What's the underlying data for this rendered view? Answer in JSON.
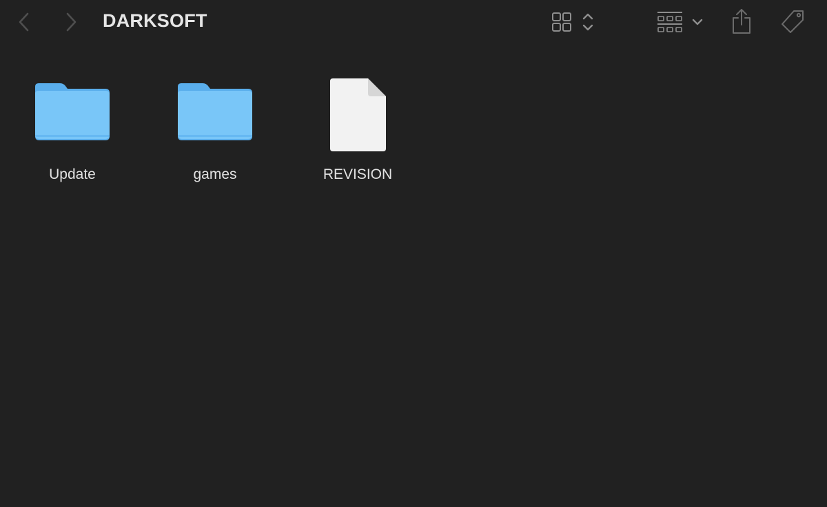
{
  "window": {
    "title": "DARKSOFT",
    "background_color": "#212121"
  },
  "toolbar": {
    "back_icon": "chevron-left-icon",
    "forward_icon": "chevron-right-icon",
    "view_icon": "icon-grid-view-icon",
    "view_chevron_icon": "up-down-chevron-icon",
    "group_icon": "group-by-icon",
    "group_chevron_icon": "chevron-down-icon",
    "share_icon": "share-icon",
    "tag_icon": "tag-icon"
  },
  "items": [
    {
      "name": "Update",
      "kind": "folder",
      "icon": "folder-icon"
    },
    {
      "name": "games",
      "kind": "folder",
      "icon": "folder-icon"
    },
    {
      "name": "REVISION",
      "kind": "document",
      "icon": "document-icon"
    }
  ],
  "colors": {
    "folder_blue": "#79c6f8",
    "folder_tab": "#5aaeec",
    "document_white": "#f2f2f2",
    "icon_gray": "#8a8a8a",
    "disabled_gray": "#4f4f4f"
  }
}
